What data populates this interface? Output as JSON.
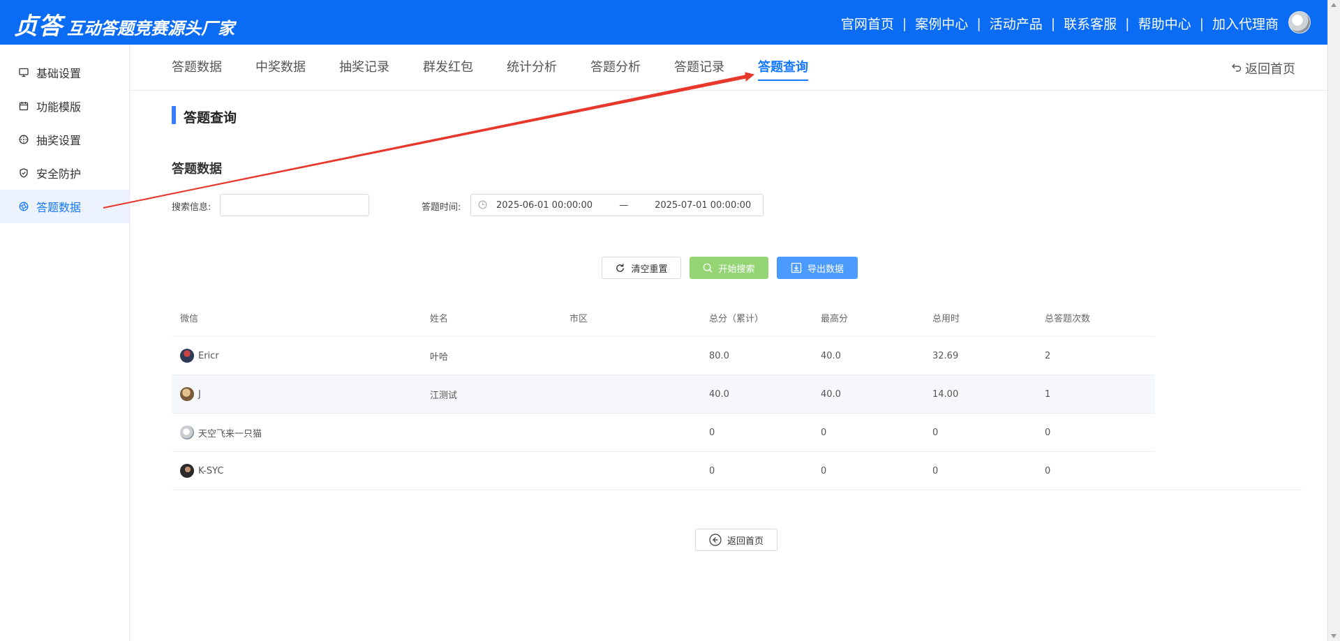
{
  "header": {
    "brand": "贞答",
    "tagline": "互动答题竞赛源头厂家",
    "nav": [
      "官网首页",
      "案例中心",
      "活动产品",
      "联系客服",
      "帮助中心",
      "加入代理商"
    ],
    "separator": "|"
  },
  "sidebar": {
    "items": [
      {
        "label": "基础设置",
        "icon": "monitor-icon"
      },
      {
        "label": "功能模版",
        "icon": "calendar-icon"
      },
      {
        "label": "抽奖设置",
        "icon": "compass-icon"
      },
      {
        "label": "安全防护",
        "icon": "shield-icon"
      },
      {
        "label": "答题数据",
        "icon": "aperture-icon",
        "active": true
      }
    ]
  },
  "tabs": {
    "items": [
      "答题数据",
      "中奖数据",
      "抽奖记录",
      "群发红包",
      "统计分析",
      "答题分析",
      "答题记录",
      "答题查询"
    ],
    "active": "答题查询",
    "back_label": "返回首页"
  },
  "page": {
    "title": "答题查询",
    "subtitle": "答题数据"
  },
  "filters": {
    "search_label": "搜索信息:",
    "search_value": "",
    "time_label": "答题时间:",
    "start": "2025-06-01 00:00:00",
    "range_sep": "—",
    "end": "2025-07-01 00:00:00"
  },
  "actions": {
    "reset": "清空重置",
    "search": "开始搜索",
    "export": "导出数据"
  },
  "table": {
    "headers": [
      "微信",
      "姓名",
      "市区",
      "总分（累计）",
      "最高分",
      "总用时",
      "总答题次数"
    ],
    "rows": [
      {
        "wechat": "Ericr",
        "name": "叶哈",
        "city": "",
        "total": "80.0",
        "max": "40.0",
        "time": "32.69",
        "count": "2"
      },
      {
        "wechat": "J",
        "name": "江测试",
        "city": "",
        "total": "40.0",
        "max": "40.0",
        "time": "14.00",
        "count": "1"
      },
      {
        "wechat": "天空飞来一只猫",
        "name": "",
        "city": "",
        "total": "0",
        "max": "0",
        "time": "0",
        "count": "0"
      },
      {
        "wechat": "K-SYC",
        "name": "",
        "city": "",
        "total": "0",
        "max": "0",
        "time": "0",
        "count": "0"
      }
    ]
  },
  "footer": {
    "back_label": "返回首页"
  },
  "colors": {
    "header_bg": "#0a6cf5",
    "accent": "#1677ff",
    "search_button": "#95d475",
    "export_button": "#4b9bff",
    "annotation_arrow": "#e8372c"
  }
}
